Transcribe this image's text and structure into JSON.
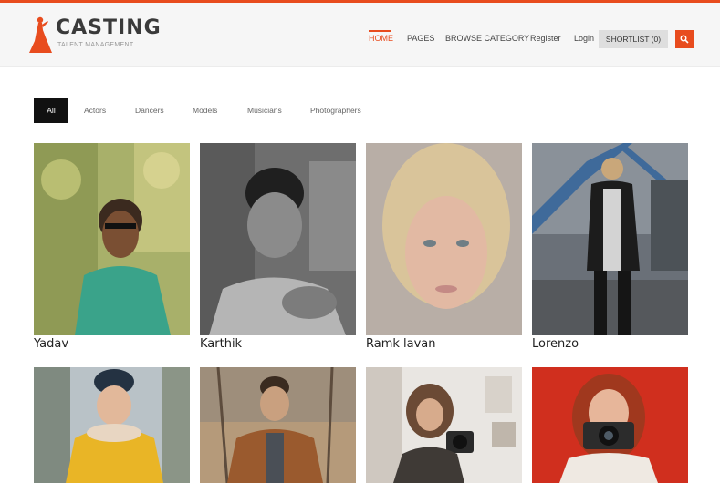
{
  "brand": {
    "title": "CASTING",
    "subtitle": "TALENT MANAGEMENT"
  },
  "nav": {
    "items": [
      {
        "label": "HOME",
        "active": true
      },
      {
        "label": "PAGES",
        "active": false
      },
      {
        "label": "BROWSE CATEGORY",
        "active": false
      },
      {
        "label": "Register",
        "active": false
      },
      {
        "label": "Login",
        "active": false
      }
    ],
    "shortlist_label": "SHORTLIST (0)",
    "search_icon": "search-icon"
  },
  "filters": [
    {
      "label": "All",
      "active": true
    },
    {
      "label": "Actors",
      "active": false
    },
    {
      "label": "Dancers",
      "active": false
    },
    {
      "label": "Models",
      "active": false
    },
    {
      "label": "Musicians",
      "active": false
    },
    {
      "label": "Photographers",
      "active": false
    }
  ],
  "talents": [
    {
      "name": "Yadav"
    },
    {
      "name": "Karthik"
    },
    {
      "name": "Ramk lavan"
    },
    {
      "name": "Lorenzo"
    },
    {
      "name": ""
    },
    {
      "name": ""
    },
    {
      "name": ""
    },
    {
      "name": ""
    }
  ],
  "colors": {
    "accent": "#e84c1e",
    "header_bg": "#f6f6f6",
    "active_filter_bg": "#111111"
  }
}
